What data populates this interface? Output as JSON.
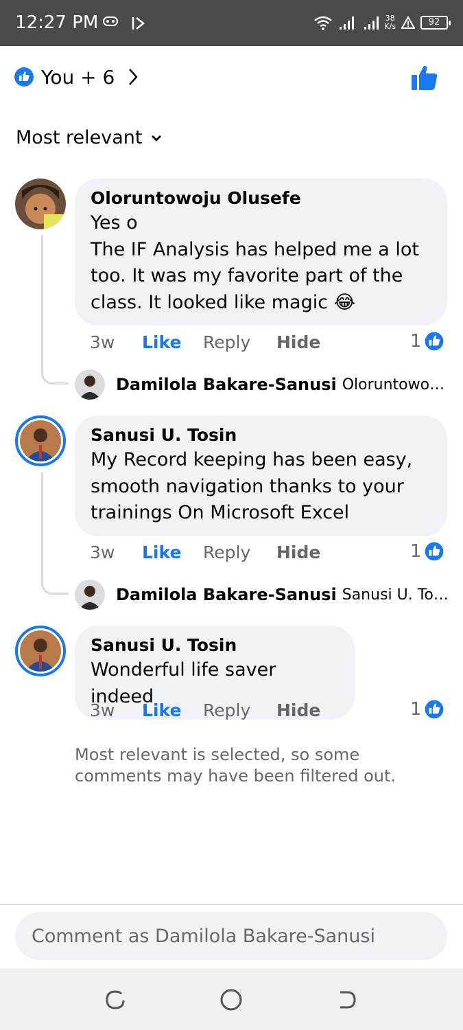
{
  "status_bar": {
    "time": "12:27 PM",
    "net_speed_value": "38",
    "net_speed_unit": "K/s",
    "battery": "92",
    "icons": [
      "gamepad-icon",
      "media-arrow-icon",
      "wifi-icon",
      "signal-icon",
      "signal-icon",
      "alert-icon",
      "battery-icon"
    ]
  },
  "reactions": {
    "summary": "You + 6"
  },
  "sort": {
    "label": "Most relevant"
  },
  "comments": [
    {
      "name": "Oloruntowoju Olusefe",
      "text": "Yes o\nThe IF Analysis has helped me a lot too. It was my favorite part of the class. It looked like magic 😂",
      "time": "3w",
      "like": "Like",
      "reply": "Reply",
      "hide": "Hide",
      "reaction_count": "1",
      "reply_preview": {
        "name": "Damilola Bakare-Sanusi",
        "snippet": "Oloruntowoju Ol..."
      }
    },
    {
      "name": "Sanusi U. Tosin",
      "text": "My Record keeping has been easy, smooth navigation thanks to your trainings On Microsoft Excel",
      "time": "3w",
      "like": "Like",
      "reply": "Reply",
      "hide": "Hide",
      "reaction_count": "1",
      "reply_preview": {
        "name": "Damilola Bakare-Sanusi",
        "snippet": "Sanusi U. Tosin..."
      }
    },
    {
      "name": "Sanusi U. Tosin",
      "text": "Wonderful life saver indeed",
      "time": "3w",
      "like": "Like",
      "reply": "Reply",
      "hide": "Hide",
      "reaction_count": "1"
    }
  ],
  "filter_note": "Most relevant is selected, so some comments may have been filtered out.",
  "composer": {
    "placeholder": "Comment as Damilola Bakare-Sanusi"
  },
  "colors": {
    "accent": "#1877f2",
    "bubble": "#f0f2f5",
    "secondary_text": "#65676b",
    "status_bar": "#4a4a4a"
  }
}
